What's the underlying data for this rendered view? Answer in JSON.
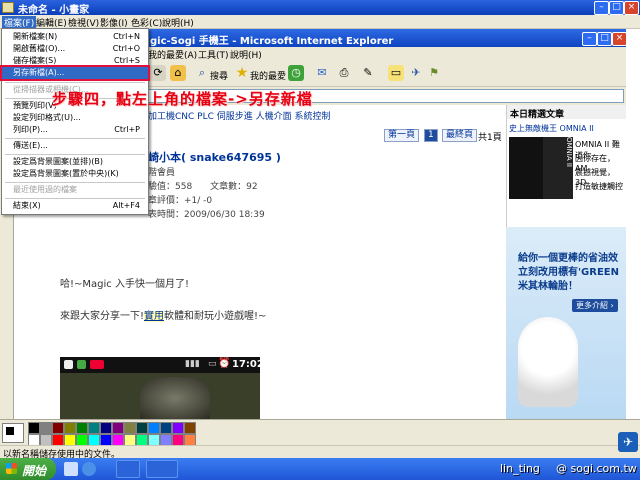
{
  "paint": {
    "title": "未命名 - 小畫家",
    "menu": [
      "檔案(F)",
      "編輯(E)",
      "檢視(V)",
      "影像(I)",
      "色彩(C)",
      "說明(H)"
    ],
    "status": "以新名稱儲存使用中的文件。"
  },
  "file_menu": {
    "items": [
      {
        "label": "開新檔案(N)",
        "shortcut": "Ctrl+N",
        "disabled": false
      },
      {
        "label": "開啟舊檔(O)...",
        "shortcut": "Ctrl+O",
        "disabled": false
      },
      {
        "label": "儲存檔案(S)",
        "shortcut": "Ctrl+S",
        "disabled": false
      },
      {
        "label": "另存新檔(A)...",
        "shortcut": "",
        "disabled": false,
        "highlighted": true
      },
      {
        "label": "從掃描器或相機(C)...",
        "shortcut": "",
        "disabled": true
      },
      {
        "label": "預覽列印(V)",
        "shortcut": "",
        "disabled": false
      },
      {
        "label": "設定列印格式(U)...",
        "shortcut": "",
        "disabled": false
      },
      {
        "label": "列印(P)...",
        "shortcut": "Ctrl+P",
        "disabled": false
      },
      {
        "label": "傳送(E)...",
        "shortcut": "",
        "disabled": false
      },
      {
        "label": "設定爲背景圖案(並排)(B)",
        "shortcut": "",
        "disabled": false
      },
      {
        "label": "設定爲背景圖案(置於中央)(K)",
        "shortcut": "",
        "disabled": false
      },
      {
        "label": "最近使用過的檔案",
        "shortcut": "",
        "disabled": true
      },
      {
        "label": "結束(X)",
        "shortcut": "Alt+F4",
        "disabled": false
      }
    ]
  },
  "instruction": "步驟四，點左上角的檔案->另存新檔",
  "ie": {
    "title": "gic-Sogi 手機王 - Microsoft Internet Explorer",
    "menu": [
      "我的最愛(A)",
      "工具(T)",
      "說明(H)"
    ],
    "toolbar_search": "搜尋",
    "toolbar_favorites": "我的最愛"
  },
  "page": {
    "breadcrumb": "加工機CNC PLC 伺服步進 人機介面 系統控制",
    "pagination": {
      "first": "第一頁",
      "current": "1",
      "last": "最終頁",
      "total": "共1頁"
    },
    "author": "崎小本( snake647695 )",
    "member": "階會員",
    "stats_line": "驗值：558　　文章數：92",
    "rating_line": "章評價：+1/ -0",
    "post_time": "表時間：2009/06/30 18:39",
    "body1": "哈!~Magic 入手快一個月了!",
    "body2_pre": "來跟大家分享一下!",
    "body2_link": "實用",
    "body2_post": "軟體和耐玩小遊戲喔!~",
    "phone_time": "17:02",
    "sidebar_title": "本日精選文章",
    "sidebar_link": "史上無敵機王 OMNIA II",
    "sidebar_lines": [
      "OMNIA II 難道你",
      "因你存在，AM",
      "震撼視覺，3D",
      "打造敏捷觸控"
    ],
    "omnia_text": "OMNIA II",
    "ad_lines": [
      "給你一個更棒的省油效",
      "立刻改用標有'GREEN",
      "米其林輪胎！"
    ],
    "ad_button": "更多介紹 ›"
  },
  "taskbar": {
    "start": "開始",
    "user": "lin_ting",
    "site": "@ sogi.com.tw"
  },
  "palette_colors": [
    "#000000",
    "#808080",
    "#800000",
    "#808000",
    "#008000",
    "#008080",
    "#000080",
    "#800080",
    "#808040",
    "#004040",
    "#0080ff",
    "#004080",
    "#8000ff",
    "#804000",
    "#ffffff",
    "#c0c0c0",
    "#ff0000",
    "#ffff00",
    "#00ff00",
    "#00ffff",
    "#0000ff",
    "#ff00ff",
    "#ffff80",
    "#00ff80",
    "#80ffff",
    "#8080ff",
    "#ff0080",
    "#ff8040"
  ]
}
